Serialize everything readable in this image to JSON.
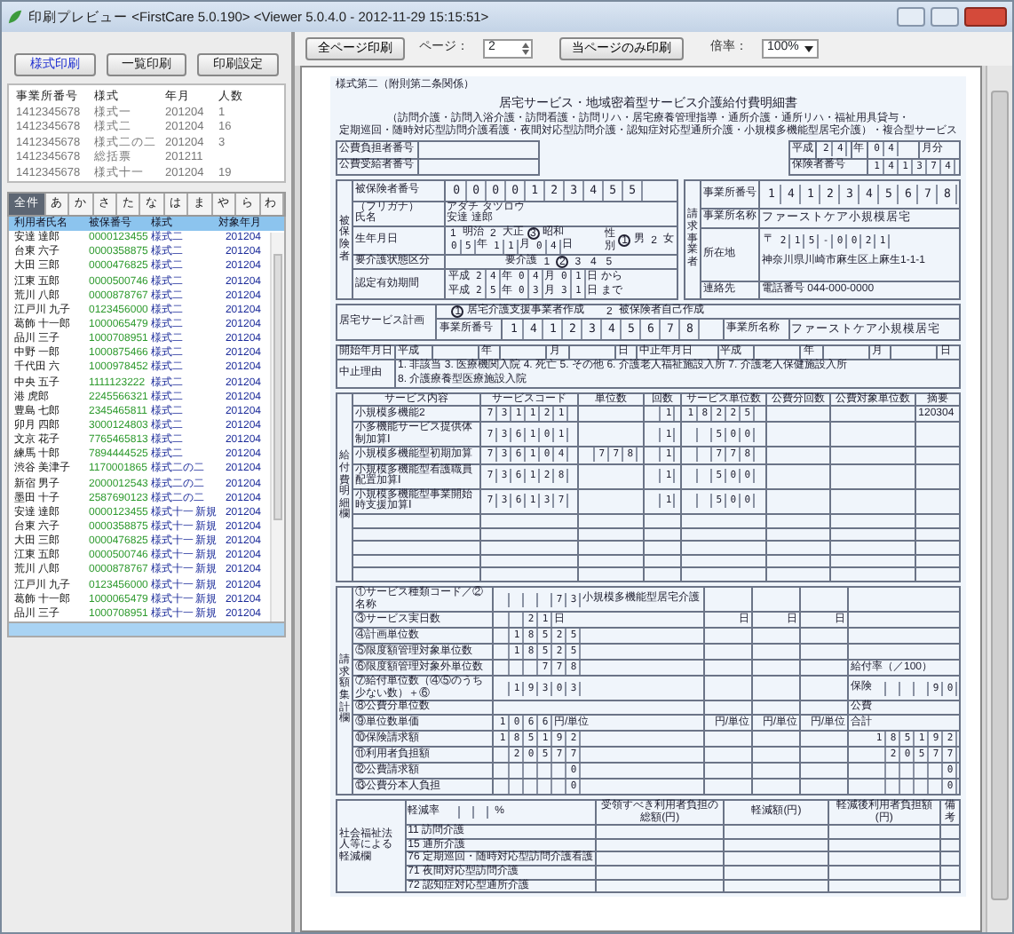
{
  "window": {
    "title": "印刷プレビュー <FirstCare 5.0.190> <Viewer 5.0.4.0 - 2012-11-29 15:15:51>"
  },
  "left_buttons": [
    {
      "label": "様式印刷",
      "selected": true
    },
    {
      "label": "一覧印刷",
      "selected": false
    },
    {
      "label": "印刷設定",
      "selected": false
    }
  ],
  "office_list": {
    "columns": [
      "事業所番号",
      "様式",
      "年月",
      "人数"
    ],
    "rows": [
      {
        "office": "1412345678",
        "form": "様式一",
        "month": "201204",
        "count": "1"
      },
      {
        "office": "1412345678",
        "form": "様式二",
        "month": "201204",
        "count": "16"
      },
      {
        "office": "1412345678",
        "form": "様式二の二",
        "month": "201204",
        "count": "3"
      },
      {
        "office": "1412345678",
        "form": "総括票",
        "month": "201211"
      },
      {
        "office": "1412345678",
        "form": "様式十一",
        "month": "201204",
        "count": "19"
      }
    ]
  },
  "kana_tabs": [
    {
      "label": "全件",
      "selected": true
    },
    {
      "label": "あ",
      "selected": false
    },
    {
      "label": "か",
      "selected": false
    },
    {
      "label": "さ",
      "selected": false
    },
    {
      "label": "た",
      "selected": false
    },
    {
      "label": "な",
      "selected": false
    },
    {
      "label": "は",
      "selected": false
    },
    {
      "label": "ま",
      "selected": false
    },
    {
      "label": "や",
      "selected": false
    },
    {
      "label": "ら",
      "selected": false
    },
    {
      "label": "わ",
      "selected": false
    }
  ],
  "patient_list": {
    "columns": [
      "利用者氏名",
      "被保番号",
      "様式",
      "対象年月"
    ],
    "rows": [
      {
        "name": "安達 達郎",
        "number": "0000123455",
        "form": "様式二",
        "month": "201204"
      },
      {
        "name": "台東 六子",
        "number": "0000358875",
        "form": "様式二",
        "month": "201204"
      },
      {
        "name": "大田 三郎",
        "number": "0000476825",
        "form": "様式二",
        "month": "201204"
      },
      {
        "name": "江東 五郎",
        "number": "0000500746",
        "form": "様式二",
        "month": "201204"
      },
      {
        "name": "荒川 八郎",
        "number": "0000878767",
        "form": "様式二",
        "month": "201204"
      },
      {
        "name": "江戸川 九子",
        "number": "0123456000",
        "form": "様式二",
        "month": "201204"
      },
      {
        "name": "葛飾 十一郎",
        "number": "1000065479",
        "form": "様式二",
        "month": "201204"
      },
      {
        "name": "品川 三子",
        "number": "1000708951",
        "form": "様式二",
        "month": "201204"
      },
      {
        "name": "中野 一郎",
        "number": "1000875466",
        "form": "様式二",
        "month": "201204"
      },
      {
        "name": "千代田 六",
        "number": "1000978452",
        "form": "様式二",
        "month": "201204"
      },
      {
        "name": "中央 五子",
        "number": "1111123222",
        "form": "様式二",
        "month": "201204"
      },
      {
        "name": "港 虎郎",
        "number": "2245566321",
        "form": "様式二",
        "month": "201204"
      },
      {
        "name": "豊島 七郎",
        "number": "2345465811",
        "form": "様式二",
        "month": "201204"
      },
      {
        "name": "卯月 四郎",
        "number": "3000124803",
        "form": "様式二",
        "month": "201204"
      },
      {
        "name": "文京 花子",
        "number": "7765465813",
        "form": "様式二",
        "month": "201204"
      },
      {
        "name": "練馬 十郎",
        "number": "7894444525",
        "form": "様式二",
        "month": "201204"
      },
      {
        "name": "渋谷 美津子",
        "number": "1170001865",
        "form": "様式二の二",
        "month": "201204"
      },
      {
        "name": "新宿 男子",
        "number": "2000012543",
        "form": "様式二の二",
        "month": "201204"
      },
      {
        "name": "墨田 十子",
        "number": "2587690123",
        "form": "様式二の二",
        "month": "201204"
      },
      {
        "name": "安達 達郎",
        "number": "0000123455",
        "form": "様式十一",
        "tag": "新規",
        "month": "201204"
      },
      {
        "name": "台東 六子",
        "number": "0000358875",
        "form": "様式十一",
        "tag": "新規",
        "month": "201204"
      },
      {
        "name": "大田 三郎",
        "number": "0000476825",
        "form": "様式十一",
        "tag": "新規",
        "month": "201204"
      },
      {
        "name": "江東 五郎",
        "number": "0000500746",
        "form": "様式十一",
        "tag": "新規",
        "month": "201204"
      },
      {
        "name": "荒川 八郎",
        "number": "0000878767",
        "form": "様式十一",
        "tag": "新規",
        "month": "201204"
      },
      {
        "name": "江戸川 九子",
        "number": "0123456000",
        "form": "様式十一",
        "tag": "新規",
        "month": "201204"
      },
      {
        "name": "葛飾 十一郎",
        "number": "1000065479",
        "form": "様式十一",
        "tag": "新規",
        "month": "201204"
      },
      {
        "name": "品川 三子",
        "number": "1000708951",
        "form": "様式十一",
        "tag": "新規",
        "month": "201204"
      }
    ]
  },
  "toolbar": {
    "print_all": "全ページ印刷",
    "page_label": "ページ：",
    "page": "2",
    "print_page": "当ページのみ印刷",
    "zoom_label": "倍率：",
    "zoom": "100%"
  },
  "document": {
    "form_no": "様式第二（附則第二条関係）",
    "title": "居宅サービス・地域密着型サービス介護給付費明細書",
    "subtitle": [
      "（訪問介護・訪問入浴介護・訪問看護・訪問リハ・居宅療養管理指導・通所介護・通所リハ・福祉用具貸与・",
      "定期巡回・随時対応型訪問介護看護・夜間対応型訪問介護・認知症対応型通所介護・小規模多機能型居宅介護）・複合型サービス"
    ],
    "public_payer_label": "公費負担者番号",
    "public_recipient_label": "公費受給者番号",
    "period": {
      "era": "平成",
      "year": "24",
      "year_unit": "年",
      "month": "04",
      "month_unit": "月分"
    },
    "insurer": {
      "label": "保険者番号",
      "number": "141374"
    },
    "insured": {
      "side_label": "被保険者",
      "number_label": "被保険者番号",
      "number": "0000123455",
      "kana_label": "（フリガナ）",
      "kana": "アダチ タツロウ",
      "name_label": "氏名",
      "name": "安達 達郎",
      "birth_label": "生年月日",
      "eras": [
        {
          "num": "1",
          "label": "明治",
          "selected": false
        },
        {
          "num": "2",
          "label": "大正",
          "selected": false
        },
        {
          "num": "3",
          "label": "昭和",
          "selected": true
        }
      ],
      "birth": [
        {
          "value": "05",
          "unit": "年"
        },
        {
          "value": "11",
          "unit": "月"
        },
        {
          "value": "04",
          "unit": "日"
        }
      ],
      "sex_label": "性別",
      "sexes": [
        {
          "num": "1",
          "label": "男",
          "selected": true
        },
        {
          "num": "2",
          "label": "女",
          "selected": false
        }
      ],
      "care_label": "要介護状態区分",
      "care_prefix": "要介護",
      "care_levels": [
        {
          "num": "1",
          "selected": false
        },
        {
          "num": "2",
          "selected": true
        },
        {
          "num": "3",
          "selected": false
        },
        {
          "num": "4",
          "selected": false
        },
        {
          "num": "5",
          "selected": false
        }
      ],
      "validity_label": "認定有効期間",
      "validity": [
        {
          "era": "平成",
          "date": [
            {
              "value": "24",
              "unit": "年"
            },
            {
              "value": "04",
              "unit": "月"
            },
            {
              "value": "01",
              "unit": "日"
            }
          ],
          "suffix": "から"
        },
        {
          "era": "平成",
          "date": [
            {
              "value": "25",
              "unit": "年"
            },
            {
              "value": "03",
              "unit": "月"
            },
            {
              "value": "31",
              "unit": "日"
            }
          ],
          "suffix": "まで"
        }
      ]
    },
    "office": {
      "side_label": "請求事業者",
      "number_label": "事業所番号",
      "number": "1412345678",
      "name_label": "事業所名称",
      "name": "ファーストケア小規模居宅",
      "address_label": "所在地",
      "postal_mark": "〒",
      "postal": "215-0021",
      "address": "神奈川県川崎市麻生区上麻生1-1-1",
      "contact_label": "連絡先",
      "phone": "電話番号 044-000-0000"
    },
    "plan": {
      "label": "居宅サービス計画",
      "options": [
        {
          "num": "1",
          "label": "居宅介護支援事業者作成",
          "selected": true
        },
        {
          "num": "2",
          "label": "被保険者自己作成",
          "selected": false
        }
      ],
      "number_label": "事業所番号",
      "number": "1412345678",
      "name_label": "事業所名称",
      "name": "ファーストケア小規模居宅"
    },
    "dates": {
      "periods": [
        {
          "label": "開始年月日",
          "era": "平成",
          "units": [
            "年",
            "月",
            "日"
          ]
        },
        {
          "label": "中止年月日",
          "era": "平成",
          "units": [
            "年",
            "月",
            "日"
          ]
        }
      ],
      "reason_label": "中止理由",
      "reasons": [
        "1. 非該当",
        "3. 医療機関入院",
        "4. 死亡",
        "5. その他",
        "6. 介護老人福祉施設入所",
        "7. 介護老人保健施設入所",
        "8. 介護療養型医療施設入院"
      ]
    },
    "services": {
      "side_label": "給付費明細欄",
      "columns": [
        "サービス内容",
        "サービスコード",
        "単位数",
        "回数",
        "サービス単位数",
        "公費分回数",
        "公費対象単位数",
        "摘要"
      ],
      "rows": [
        {
          "name": "小規模多機能2",
          "code": "731121",
          "count": "1",
          "total": "18225",
          "note": "120304"
        },
        {
          "name": "小多機能サービス提供体制加算Ⅰ",
          "code": "736101",
          "count": "1",
          "total": "500"
        },
        {
          "name": "小規模多機能型初期加算",
          "code": "736104",
          "units": "778",
          "count": "1",
          "total": "778"
        },
        {
          "name": "小規模多機能型看護職員配置加算Ⅰ",
          "code": "736128",
          "count": "1",
          "total": "500"
        },
        {
          "name": "小規模多機能型事業開始時支援加算Ⅰ",
          "code": "736137",
          "count": "1",
          "total": "500"
        }
      ]
    },
    "totals": {
      "side_label": "請求額集計欄",
      "rows": [
        {
          "label": "①サービス種類コード／②名称",
          "value": "73",
          "text": "小規模多機能型居宅介護"
        },
        {
          "label": "③サービス実日数",
          "value": "21",
          "unit": "日",
          "column_units": [
            "日",
            "日",
            "日"
          ]
        },
        {
          "label": "④計画単位数",
          "value": "18525"
        },
        {
          "label": "⑤限度額管理対象単位数",
          "value": "18525"
        },
        {
          "label": "⑥限度額管理対象外単位数",
          "value": "778",
          "right_label": "給付率（／100）"
        },
        {
          "label": "⑦給付単位数（④⑤のうち少ない数）＋⑥",
          "value": "19303",
          "right_label": "保険",
          "right_value": "90"
        },
        {
          "label": "⑧公費分単位数",
          "right_label": "公費"
        },
        {
          "label": "⑨単位数単価",
          "value": "1066",
          "unit": "円/単位",
          "column_units": [
            "円/単位",
            "円/単位",
            "円/単位"
          ],
          "right_label": "合計"
        },
        {
          "label": "⑩保険請求額",
          "value": "185192",
          "right_value": "185192"
        },
        {
          "label": "⑪利用者負担額",
          "value": "20577",
          "right_value": "20577"
        },
        {
          "label": "⑫公費請求額",
          "value": "0",
          "right_value": "0"
        },
        {
          "label": "⑬公費分本人負担",
          "value": "0",
          "right_value": "0"
        }
      ]
    },
    "reduction": {
      "side_label": "社会福祉法人等による軽減欄",
      "rate_label": "軽減率",
      "rate_unit": "%",
      "columns": [
        "受領すべき利用者負担の総額(円)",
        "軽減額(円)",
        "軽減後利用者負担額(円)",
        "備考"
      ],
      "services": [
        {
          "code": "11",
          "name": "訪問介護"
        },
        {
          "code": "15",
          "name": "通所介護"
        },
        {
          "code": "76",
          "name": "定期巡回・随時対応型訪問介護看護"
        },
        {
          "code": "71",
          "name": "夜間対応型訪問介護"
        },
        {
          "code": "72",
          "name": "認知症対応型通所介護"
        }
      ]
    }
  }
}
